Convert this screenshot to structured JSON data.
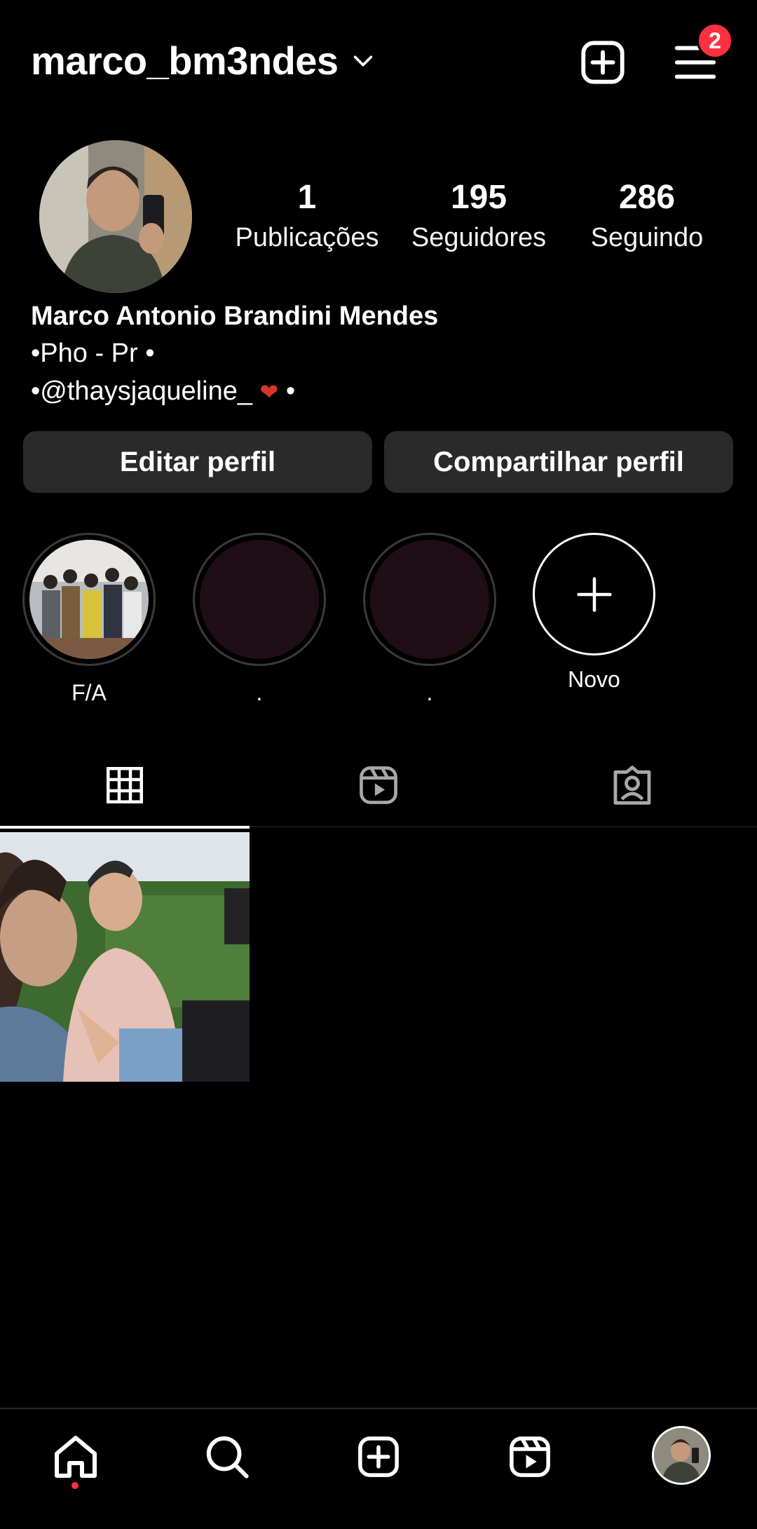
{
  "header": {
    "username": "marco_bm3ndes",
    "notification_count": "2"
  },
  "profile": {
    "stats": [
      {
        "value": "1",
        "label": "Publicações"
      },
      {
        "value": "195",
        "label": "Seguidores"
      },
      {
        "value": "286",
        "label": "Seguindo"
      }
    ],
    "full_name": "Marco Antonio Brandini Mendes",
    "bio_line1": "•Pho - Pr •",
    "bio_line2": "•@thaysjaqueline_ ",
    "bio_line2_emoji": "❤",
    "bio_line2_end": " •"
  },
  "actions": {
    "edit_label": "Editar perfil",
    "share_label": "Compartilhar perfil"
  },
  "highlights": [
    {
      "label": "F/A"
    },
    {
      "label": "."
    },
    {
      "label": "."
    }
  ],
  "new_highlight_label": "Novo",
  "tabs": [
    "posts-grid",
    "reels",
    "tagged"
  ],
  "bottom_nav": [
    "home-icon",
    "search-icon",
    "create-icon",
    "reels-icon",
    "profile-avatar"
  ],
  "colors": {
    "background": "#000000",
    "button": "#2a2a2a",
    "badge": "#ff3040",
    "divider": "#262626"
  }
}
